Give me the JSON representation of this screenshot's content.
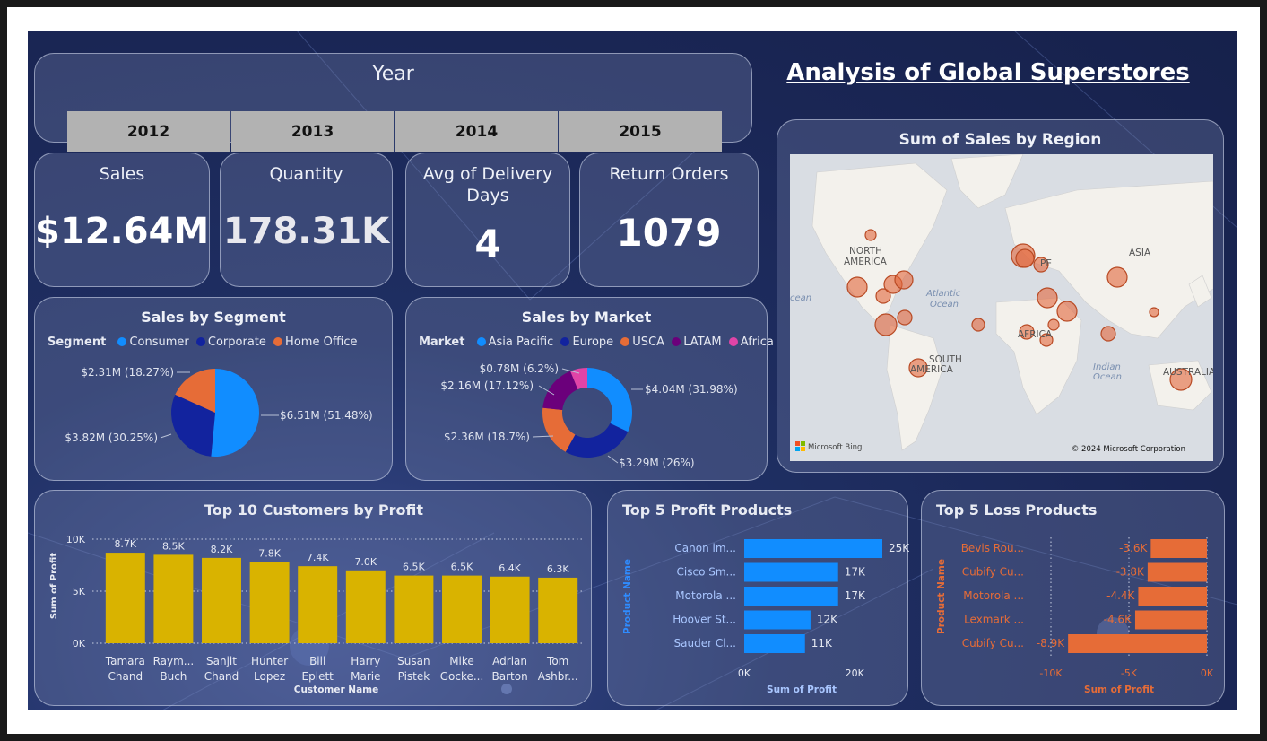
{
  "title": "Analysis of Global Superstores",
  "year_slicer": {
    "label": "Year",
    "years": [
      "2012",
      "2013",
      "2014",
      "2015"
    ]
  },
  "kpis": {
    "sales": {
      "label": "Sales",
      "value": "$12.64M"
    },
    "quantity": {
      "label": "Quantity",
      "value": "178.31K"
    },
    "delivery": {
      "label1": "Avg of Delivery",
      "label2": "Days",
      "value": "4"
    },
    "returns": {
      "label": "Return Orders",
      "value": "1079"
    }
  },
  "segment": {
    "title": "Sales by Segment",
    "legend_title": "Segment",
    "legend": [
      {
        "name": "Consumer",
        "color": "#118dff"
      },
      {
        "name": "Corporate",
        "color": "#12239e"
      },
      {
        "name": "Home Office",
        "color": "#e66c37"
      }
    ],
    "labels": [
      "$6.51M (51.48%)",
      "$3.82M (30.25%)",
      "$2.31M (18.27%)"
    ]
  },
  "market": {
    "title": "Sales by Market",
    "legend_title": "Market",
    "legend": [
      {
        "name": "Asia Pacific",
        "color": "#118dff"
      },
      {
        "name": "Europe",
        "color": "#12239e"
      },
      {
        "name": "USCA",
        "color": "#e66c37"
      },
      {
        "name": "LATAM",
        "color": "#6b007b"
      },
      {
        "name": "Africa",
        "color": "#e044a7"
      }
    ],
    "labels": [
      "$4.04M (31.98%)",
      "$3.29M (26%)",
      "$2.36M (18.7%)",
      "$2.16M (17.12%)",
      "$0.78M (6.2%)"
    ]
  },
  "map": {
    "title": "Sum of Sales by Region",
    "labels": {
      "na": "NORTH\nAMERICA",
      "north": "NORTH",
      "america": "AMERICA",
      "south": "SOUTH",
      "south_america": "AMERICA",
      "asia": "ASIA",
      "africa": "AFRICA",
      "europe": "PE",
      "australia": "AUSTRALIA",
      "atlantic1": "Atlantic",
      "atlantic2": "Ocean",
      "indian1": "Indian",
      "indian2": "Ocean",
      "ocean_left": "cean"
    },
    "bing": "Microsoft Bing",
    "copyright": "© 2024 Microsoft Corporation"
  },
  "chart_data": [
    {
      "type": "pie",
      "title": "Sales by Segment",
      "categories": [
        "Consumer",
        "Corporate",
        "Home Office"
      ],
      "values": [
        6.51,
        3.82,
        2.31
      ],
      "unit": "$M",
      "percent": [
        51.48,
        30.25,
        18.27
      ],
      "colors": [
        "#118dff",
        "#12239e",
        "#e66c37"
      ]
    },
    {
      "type": "pie",
      "title": "Sales by Market",
      "categories": [
        "Asia Pacific",
        "Europe",
        "USCA",
        "LATAM",
        "Africa"
      ],
      "values": [
        4.04,
        3.29,
        2.36,
        2.16,
        0.78
      ],
      "unit": "$M",
      "percent": [
        31.98,
        26,
        18.7,
        17.12,
        6.2
      ],
      "colors": [
        "#118dff",
        "#12239e",
        "#e66c37",
        "#6b007b",
        "#e044a7"
      ]
    },
    {
      "type": "bar",
      "title": "Top 10 Customers by Profit",
      "xlabel": "Customer Name",
      "ylabel": "Sum of Profit",
      "categories": [
        [
          "Tamara",
          "Chand"
        ],
        [
          "Raym...",
          "Buch"
        ],
        [
          "Sanjit",
          "Chand"
        ],
        [
          "Hunter",
          "Lopez"
        ],
        [
          "Bill",
          "Eplett"
        ],
        [
          "Harry",
          "Marie"
        ],
        [
          "Susan",
          "Pistek"
        ],
        [
          "Mike",
          "Gocke..."
        ],
        [
          "Adrian",
          "Barton"
        ],
        [
          "Tom",
          "Ashbr..."
        ]
      ],
      "values": [
        8700,
        8500,
        8200,
        7800,
        7400,
        7000,
        6500,
        6500,
        6400,
        6300
      ],
      "data_labels": [
        "8.7K",
        "8.5K",
        "8.2K",
        "7.8K",
        "7.4K",
        "7.0K",
        "6.5K",
        "6.5K",
        "6.4K",
        "6.3K"
      ],
      "ylim": [
        0,
        10000
      ],
      "yticks": [
        "10K",
        "5K",
        "0K"
      ],
      "color": "#d9b300"
    },
    {
      "type": "bar",
      "orientation": "horizontal",
      "title": "Top 5 Profit Products",
      "xlabel": "Sum of Profit",
      "ylabel": "Product Name",
      "categories": [
        "Canon im...",
        "Cisco Sm...",
        "Motorola ...",
        "Hoover St...",
        "Sauder Cl..."
      ],
      "values": [
        25000,
        17000,
        17000,
        12000,
        11000
      ],
      "data_labels": [
        "25K",
        "17K",
        "17K",
        "12K",
        "11K"
      ],
      "xlim": [
        0,
        25000
      ],
      "xticks": [
        "0K",
        "20K"
      ],
      "color": "#118dff"
    },
    {
      "type": "bar",
      "orientation": "horizontal",
      "title": "Top 5 Loss Products",
      "xlabel": "Sum of Profit",
      "ylabel": "Product Name",
      "categories": [
        "Bevis Rou...",
        "Cubify Cu...",
        "Motorola ...",
        "Lexmark ...",
        "Cubify Cu..."
      ],
      "values": [
        -3600,
        -3800,
        -4400,
        -4600,
        -8900
      ],
      "data_labels": [
        "-3.6K",
        "-3.8K",
        "-4.4K",
        "-4.6K",
        "-8.9K"
      ],
      "xlim": [
        -10000,
        0
      ],
      "xticks": [
        "-10K",
        "-5K",
        "0K"
      ],
      "color": "#e66c37"
    }
  ]
}
